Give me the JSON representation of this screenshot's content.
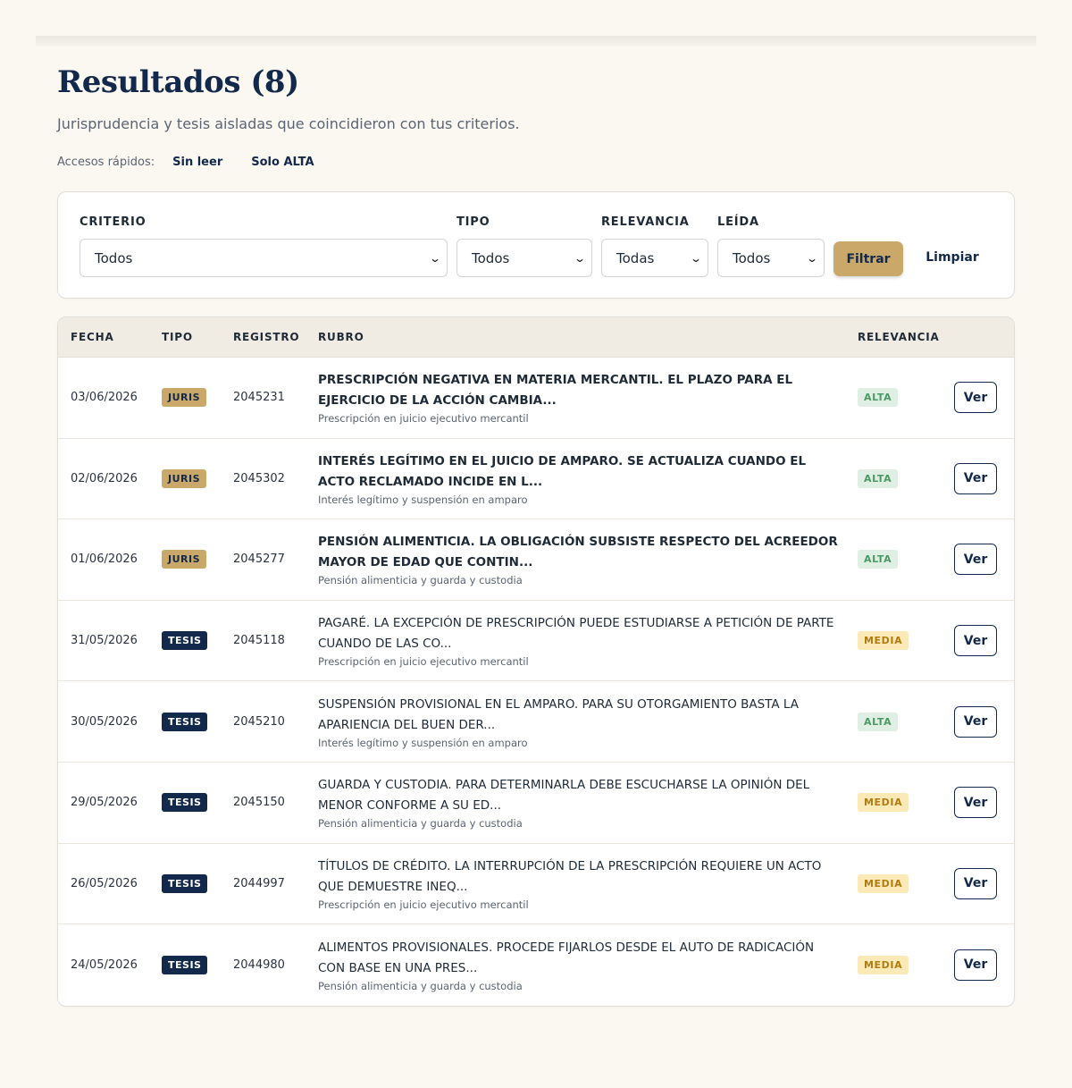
{
  "header": {
    "title": "Resultados (8)",
    "subtitle": "Jurisprudencia y tesis aisladas que coincidieron con tus criterios."
  },
  "quick_access": {
    "label": "Accesos rápidos:",
    "links": [
      "Sin leer",
      "Solo ALTA"
    ]
  },
  "filters": {
    "criterio": {
      "label": "CRITERIO",
      "value": "Todos"
    },
    "tipo": {
      "label": "TIPO",
      "value": "Todos"
    },
    "relevancia": {
      "label": "RELEVANCIA",
      "value": "Todas"
    },
    "leida": {
      "label": "LEÍDA",
      "value": "Todos"
    },
    "filter_button": "Filtrar",
    "clear_button": "Limpiar"
  },
  "table": {
    "headers": {
      "fecha": "FECHA",
      "tipo": "TIPO",
      "registro": "REGISTRO",
      "rubro": "RUBRO",
      "relevancia": "RELEVANCIA"
    },
    "action_label": "Ver",
    "rows": [
      {
        "fecha": "03/06/2026",
        "tipo": "JURIS",
        "registro": "2045231",
        "rubro": "PRESCRIPCIÓN NEGATIVA EN MATERIA MERCANTIL. EL PLAZO PARA EL EJERCICIO DE LA ACCIÓN CAMBIA...",
        "criterio": "Prescripción en juicio ejecutivo mercantil",
        "relevancia": "ALTA",
        "unread": true
      },
      {
        "fecha": "02/06/2026",
        "tipo": "JURIS",
        "registro": "2045302",
        "rubro": "INTERÉS LEGÍTIMO EN EL JUICIO DE AMPARO. SE ACTUALIZA CUANDO EL ACTO RECLAMADO INCIDE EN L...",
        "criterio": "Interés legítimo y suspensión en amparo",
        "relevancia": "ALTA",
        "unread": true
      },
      {
        "fecha": "01/06/2026",
        "tipo": "JURIS",
        "registro": "2045277",
        "rubro": "PENSIÓN ALIMENTICIA. LA OBLIGACIÓN SUBSISTE RESPECTO DEL ACREEDOR MAYOR DE EDAD QUE CONTIN...",
        "criterio": "Pensión alimenticia y guarda y custodia",
        "relevancia": "ALTA",
        "unread": true
      },
      {
        "fecha": "31/05/2026",
        "tipo": "TESIS",
        "registro": "2045118",
        "rubro": "PAGARÉ. LA EXCEPCIÓN DE PRESCRIPCIÓN PUEDE ESTUDIARSE A PETICIÓN DE PARTE CUANDO DE LAS CO...",
        "criterio": "Prescripción en juicio ejecutivo mercantil",
        "relevancia": "MEDIA",
        "unread": false
      },
      {
        "fecha": "30/05/2026",
        "tipo": "TESIS",
        "registro": "2045210",
        "rubro": "SUSPENSIÓN PROVISIONAL EN EL AMPARO. PARA SU OTORGAMIENTO BASTA LA APARIENCIA DEL BUEN DER...",
        "criterio": "Interés legítimo y suspensión en amparo",
        "relevancia": "ALTA",
        "unread": false
      },
      {
        "fecha": "29/05/2026",
        "tipo": "TESIS",
        "registro": "2045150",
        "rubro": "GUARDA Y CUSTODIA. PARA DETERMINARLA DEBE ESCUCHARSE LA OPINIÓN DEL MENOR CONFORME A SU ED...",
        "criterio": "Pensión alimenticia y guarda y custodia",
        "relevancia": "MEDIA",
        "unread": false
      },
      {
        "fecha": "26/05/2026",
        "tipo": "TESIS",
        "registro": "2044997",
        "rubro": "TÍTULOS DE CRÉDITO. LA INTERRUPCIÓN DE LA PRESCRIPCIÓN REQUIERE UN ACTO QUE DEMUESTRE INEQ...",
        "criterio": "Prescripción en juicio ejecutivo mercantil",
        "relevancia": "MEDIA",
        "unread": false
      },
      {
        "fecha": "24/05/2026",
        "tipo": "TESIS",
        "registro": "2044980",
        "rubro": "ALIMENTOS PROVISIONALES. PROCEDE FIJARLOS DESDE EL AUTO DE RADICACIÓN CON BASE EN UNA PRES...",
        "criterio": "Pensión alimenticia y guarda y custodia",
        "relevancia": "MEDIA",
        "unread": false
      }
    ]
  },
  "colors": {
    "navy": "#13294b",
    "gold": "#c9a86a",
    "background": "#fbf8f2",
    "alta_bg": "#e0efe4",
    "alta_text": "#4b9a65",
    "media_bg": "#fbe9b7",
    "media_text": "#b07c0f"
  },
  "icons": {
    "select_chevron": "chevron-down-icon"
  }
}
